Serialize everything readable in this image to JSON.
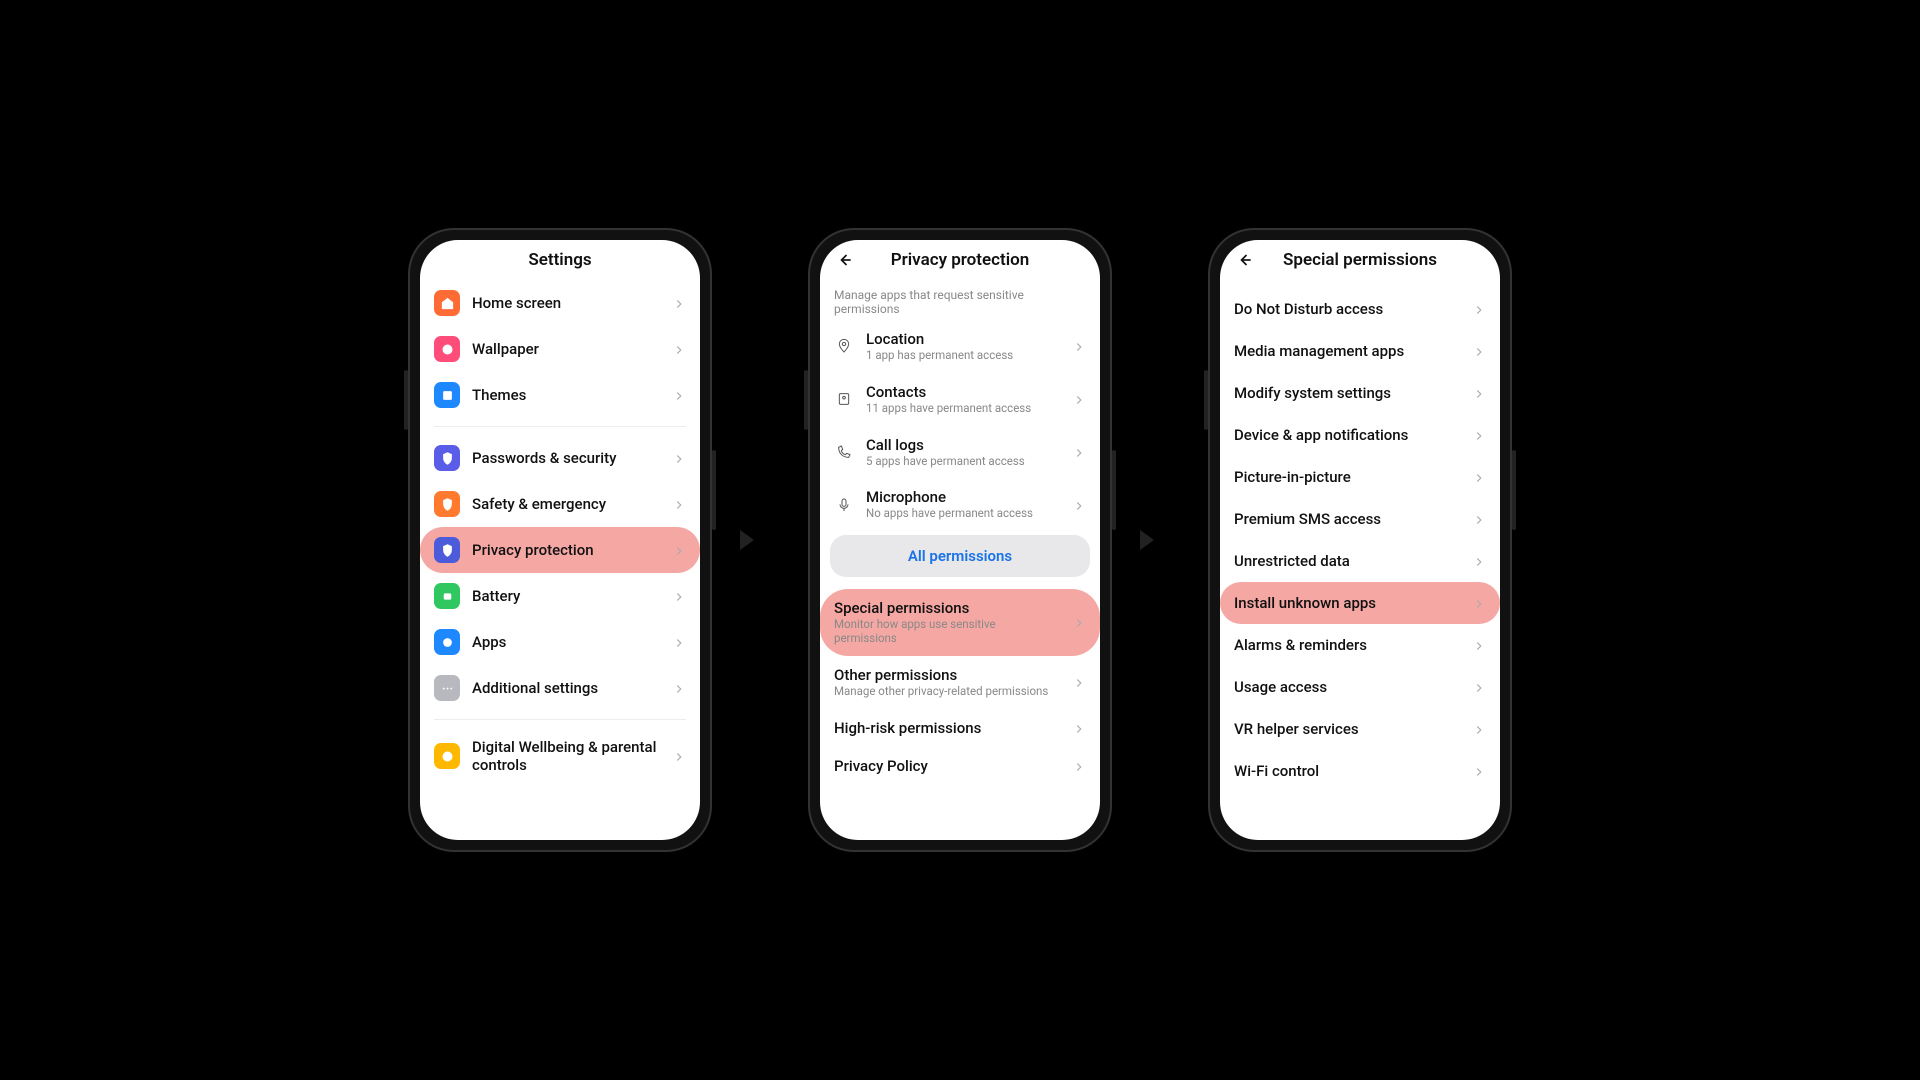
{
  "phone1": {
    "title": "Settings",
    "items": [
      {
        "label": "Home screen"
      },
      {
        "label": "Wallpaper"
      },
      {
        "label": "Themes"
      }
    ],
    "items2": [
      {
        "label": "Passwords & security"
      },
      {
        "label": "Safety & emergency"
      },
      {
        "label": "Privacy protection"
      },
      {
        "label": "Battery"
      },
      {
        "label": "Apps"
      },
      {
        "label": "Additional settings"
      }
    ],
    "items3": [
      {
        "label": "Digital Wellbeing & parental controls"
      }
    ]
  },
  "phone2": {
    "title": "Privacy protection",
    "hint": "Manage apps that request sensitive permissions",
    "perms": [
      {
        "label": "Location",
        "sub": "1 app has permanent access"
      },
      {
        "label": "Contacts",
        "sub": "11 apps have permanent access"
      },
      {
        "label": "Call logs",
        "sub": "5 apps have permanent access"
      },
      {
        "label": "Microphone",
        "sub": "No apps have permanent access"
      }
    ],
    "all_btn": "All permissions",
    "links": [
      {
        "label": "Special permissions",
        "sub": "Monitor how apps use sensitive permissions"
      },
      {
        "label": "Other permissions",
        "sub": "Manage other privacy-related permissions"
      },
      {
        "label": "High-risk permissions"
      },
      {
        "label": "Privacy Policy"
      }
    ]
  },
  "phone3": {
    "title": "Special permissions",
    "items": [
      {
        "label": "Do Not Disturb access"
      },
      {
        "label": "Media management apps"
      },
      {
        "label": "Modify system settings"
      },
      {
        "label": "Device & app notifications"
      },
      {
        "label": "Picture-in-picture"
      },
      {
        "label": "Premium SMS access"
      },
      {
        "label": "Unrestricted data"
      },
      {
        "label": "Install unknown apps"
      },
      {
        "label": "Alarms & reminders"
      },
      {
        "label": "Usage access"
      },
      {
        "label": "VR helper services"
      },
      {
        "label": "Wi-Fi control"
      }
    ]
  }
}
